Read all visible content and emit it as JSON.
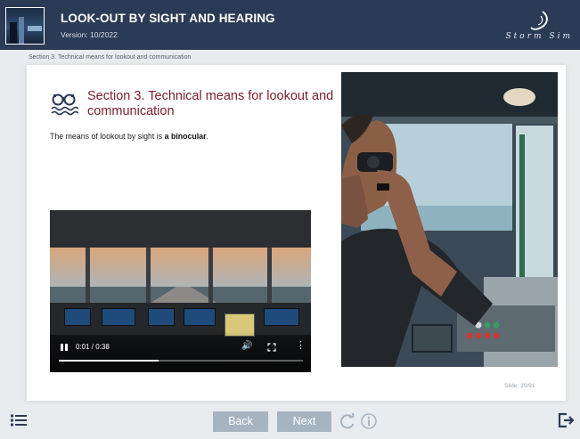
{
  "header": {
    "title": "LOOK-OUT BY SIGHT AND HEARING",
    "version": "Version: 10/2022",
    "brand": "Storm Sim",
    "logo_icon": "bridge-logo-image"
  },
  "breadcrumb": "Section 3. Technical means for lookout and communication",
  "content": {
    "heading_icon": "binoculars-icon",
    "heading": "Section 3. Technical means for lookout and communication",
    "text_before": "The means of lookout by sight is ",
    "text_bold": "a binocular",
    "text_after": "."
  },
  "video": {
    "time": "0:01 / 0:38",
    "progress": 0.41
  },
  "photo": {
    "description_icon": "sailor-with-binoculars-image"
  },
  "slide_counter": "Slide: 20/91",
  "footer": {
    "back_label": "Back",
    "next_label": "Next",
    "menu_icon": "list-menu-icon",
    "reload_icon": "reload-icon",
    "info_icon": "info-icon",
    "exit_icon": "exit-icon"
  },
  "colors": {
    "header_bg": "#2b3a55",
    "heading_color": "#7b1f2a",
    "button_bg": "#a6b3c0",
    "icon_color": "#2b3a55"
  }
}
